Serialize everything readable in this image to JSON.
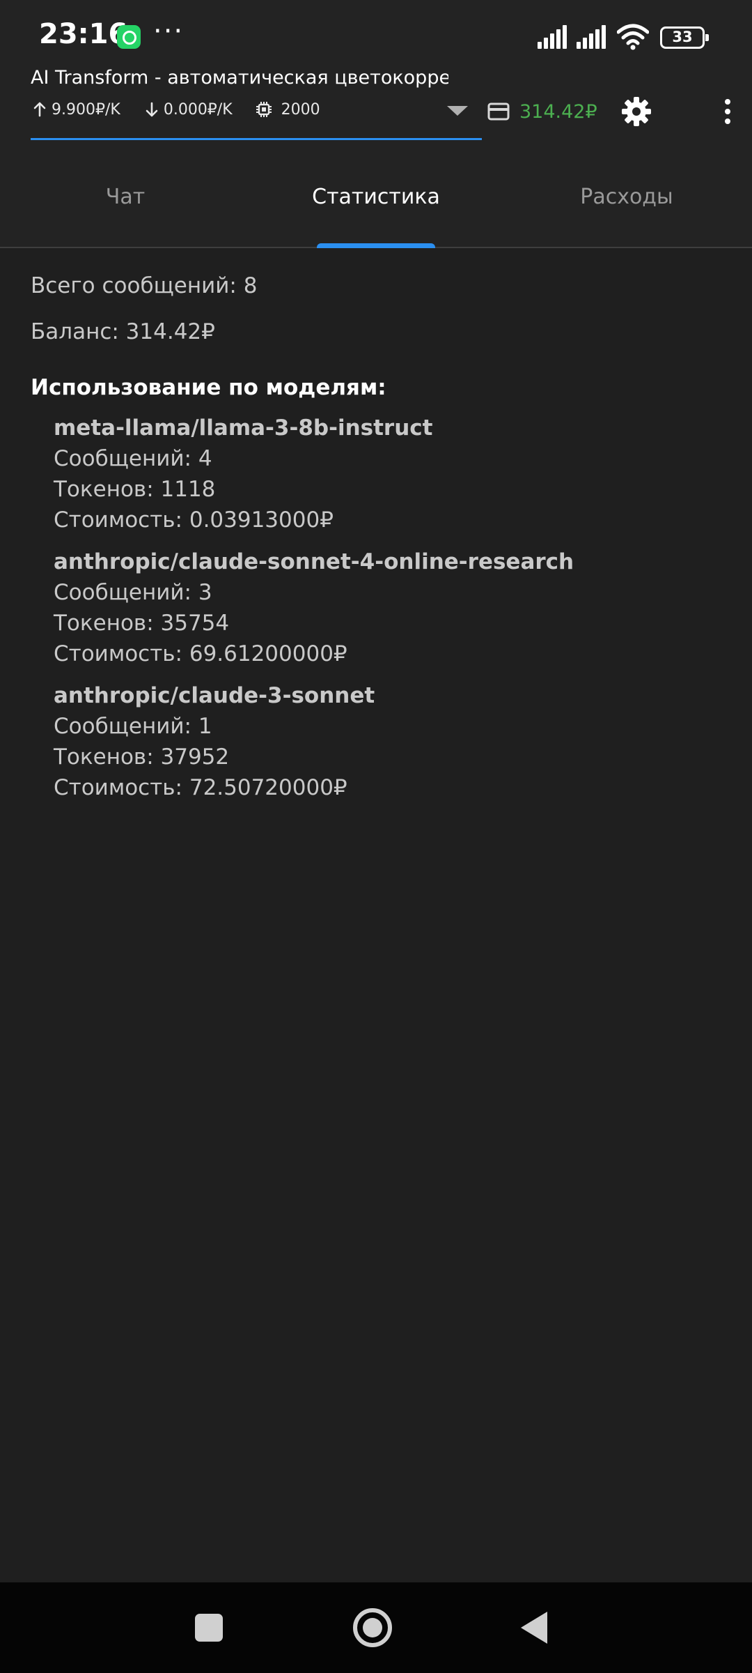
{
  "status_bar": {
    "time": "23:16",
    "more": "···",
    "battery": "33",
    "icons": [
      "whatsapp-icon",
      "signal-icon",
      "signal-icon",
      "wifi-icon",
      "battery-icon"
    ]
  },
  "toolbar": {
    "title": "AI Transform - автоматическая цветокоррек…",
    "input_price": "9.900₽/K",
    "output_price": "0.000₽/K",
    "max_tokens": "2000",
    "balance": "314.42₽",
    "balance_color": "#4caf50",
    "accent_color": "#2b8ff0"
  },
  "tabs": [
    {
      "label": "Чат",
      "active": false
    },
    {
      "label": "Статистика",
      "active": true
    },
    {
      "label": "Расходы",
      "active": false
    }
  ],
  "stats": {
    "total_messages": "Всего сообщений: 8",
    "balance": "Баланс: 314.42₽",
    "models_title": "Использование по моделям:",
    "models": [
      {
        "name": "meta-llama/llama-3-8b-instruct",
        "messages": "Сообщений: 4",
        "tokens": "Токенов: 1118",
        "cost": "Стоимость: 0.03913000₽"
      },
      {
        "name": "anthropic/claude-sonnet-4-online-research",
        "messages": "Сообщений: 3",
        "tokens": "Токенов: 35754",
        "cost": "Стоимость: 69.61200000₽"
      },
      {
        "name": "anthropic/claude-3-sonnet",
        "messages": "Сообщений: 1",
        "tokens": "Токенов: 37952",
        "cost": "Стоимость: 72.50720000₽"
      }
    ]
  },
  "nav_bar": {
    "icons": [
      "recents-icon",
      "home-icon",
      "back-icon"
    ]
  }
}
